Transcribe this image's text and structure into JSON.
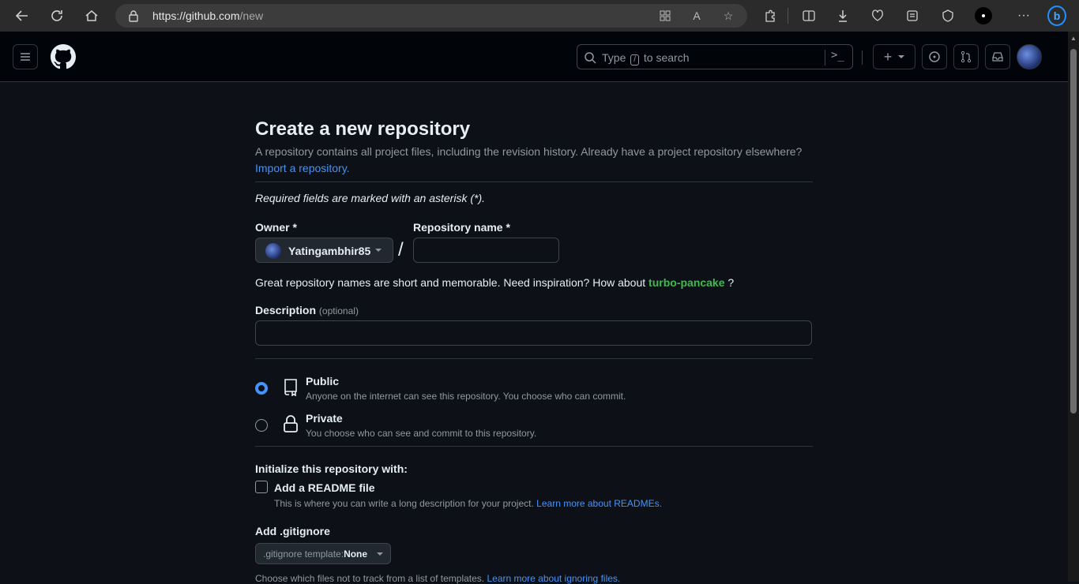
{
  "browser": {
    "url_host": "https://github.com",
    "url_path": "/new"
  },
  "header": {
    "search_prefix": "Type",
    "search_slash": "/",
    "search_suffix": "to search",
    "command_glyph": ">_",
    "new_button": "+"
  },
  "page": {
    "title": "Create a new repository",
    "subtitle": "A repository contains all project files, including the revision history. Already have a project repository elsewhere?",
    "import_link": "Import a repository.",
    "required_note": "Required fields are marked with an asterisk (*).",
    "owner_label": "Owner *",
    "owner_value": "Yatingambhir85",
    "separator": "/",
    "repo_name_label": "Repository name *",
    "repo_name_value": "",
    "hint_text": "Great repository names are short and memorable. Need inspiration? How about",
    "hint_suggestion": "turbo-pancake",
    "hint_end": "?",
    "description_label": "Description",
    "description_optional": "(optional)",
    "description_value": "",
    "visibility": {
      "public_title": "Public",
      "public_desc": "Anyone on the internet can see this repository. You choose who can commit.",
      "public_selected": true,
      "private_title": "Private",
      "private_desc": "You choose who can see and commit to this repository.",
      "private_selected": false
    },
    "init_heading": "Initialize this repository with:",
    "readme_label": "Add a README file",
    "readme_checked": false,
    "readme_desc": "This is where you can write a long description for your project.",
    "readme_link": "Learn more about READMEs.",
    "gitignore_heading": "Add .gitignore",
    "gitignore_template_label": ".gitignore template:",
    "gitignore_template_value": "None",
    "gitignore_desc": "Choose which files not to track from a list of templates.",
    "gitignore_link": "Learn more about ignoring files."
  },
  "colors": {
    "background": "#0d1117",
    "header_bg": "#010409",
    "link": "#4493f8",
    "suggestion": "#3fb950",
    "muted": "#9198a1"
  }
}
